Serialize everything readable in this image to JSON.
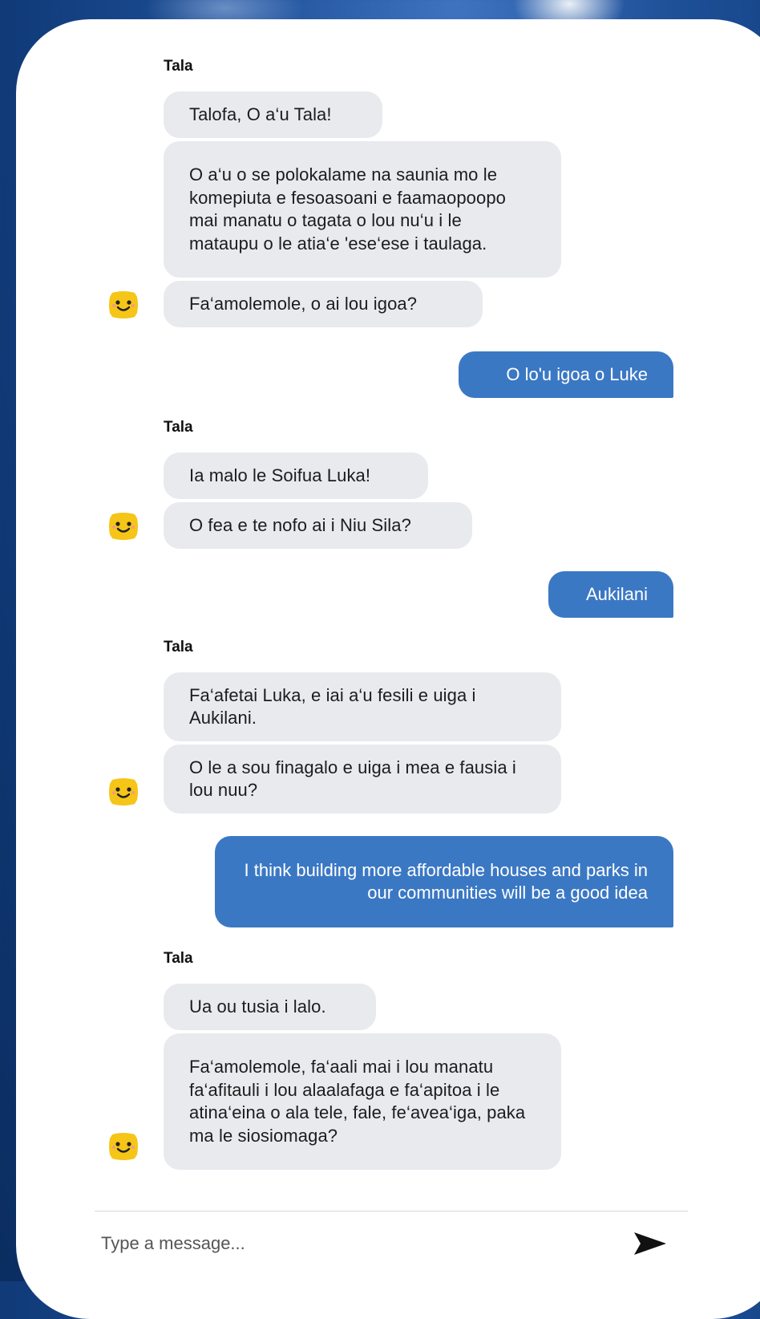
{
  "chat": {
    "sender_name": "Tala",
    "messages": {
      "m1": "Talofa, O a‘u Tala!",
      "m2": "O a‘u o se polokalame na saunia mo le komepiuta e fesoasoani e faamaopoopo mai manatu o tagata o lou nu‘u i le mataupu o le atia‘e 'ese‘ese i taulaga.",
      "m3": "Fa‘amolemole, o ai lou igoa?",
      "u1": "O lo'u igoa o Luke",
      "m4": "Ia malo le Soifua Luka!",
      "m5": "O fea e te nofo ai i Niu Sila?",
      "u2": "Aukilani",
      "m6": "Fa‘afetai Luka, e iai a‘u fesili e uiga i Aukilani.",
      "m7": "O le a sou finagalo e uiga i mea e fausia i lou nuu?",
      "u3": "I think building more affordable houses and parks in our communities will be a good idea",
      "m8": "Ua ou tusia i lalo.",
      "m9": "Fa‘amolemole, fa‘aali mai i lou manatu fa‘afitauli i lou alaalafaga e fa‘apitoa i le atina‘eina o ala tele, fale, fe‘avea‘iga, paka ma le siosiomaga?"
    }
  },
  "composer": {
    "placeholder": "Type a message...",
    "send_icon": "send-icon"
  },
  "colors": {
    "incoming_bubble": "#e8eaee",
    "outgoing_bubble": "#3b78c4",
    "avatar": "#f5c518"
  }
}
